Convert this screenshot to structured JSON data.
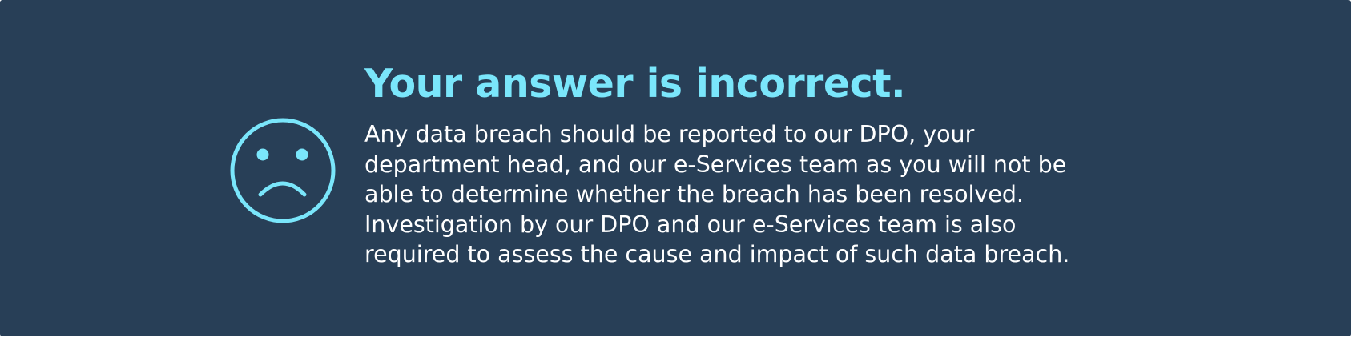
{
  "feedback": {
    "title": "Your answer is incorrect.",
    "message_lines": [
      "Any data breach should be reported to our DPO, your",
      "department head, and our e-Services team as you will not be",
      "able to determine whether the breach has been resolved.",
      "Investigation by our DPO and our e-Services team is also",
      "required to assess the cause and impact of such data breach."
    ],
    "icon": "sad-face-icon"
  },
  "colors": {
    "panel_background": "#283f57",
    "accent": "#7ae6fb",
    "text": "#ffffff"
  }
}
